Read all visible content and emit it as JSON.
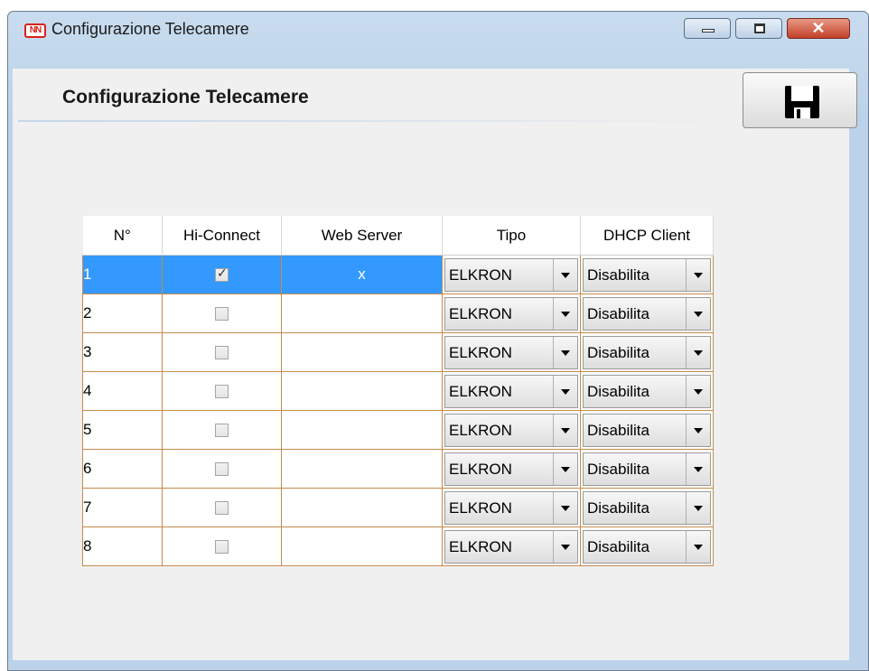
{
  "window": {
    "title": "Configurazione Telecamere",
    "icon": "app-logo-icon",
    "icon_text": "NN",
    "controls": [
      "minimize-icon",
      "maximize-icon",
      "close-icon"
    ]
  },
  "header": {
    "title": "Configurazione Telecamere",
    "save_icon": "floppy-disk-icon"
  },
  "table": {
    "columns": [
      "N°",
      "Hi-Connect",
      "Web Server",
      "Tipo",
      "DHCP Client"
    ],
    "rows": [
      {
        "n": "1",
        "hi_connect": true,
        "web_server": "x",
        "tipo": "ELKRON",
        "dhcp": "Disabilita",
        "selected": true
      },
      {
        "n": "2",
        "hi_connect": false,
        "web_server": "",
        "tipo": "ELKRON",
        "dhcp": "Disabilita",
        "selected": false
      },
      {
        "n": "3",
        "hi_connect": false,
        "web_server": "",
        "tipo": "ELKRON",
        "dhcp": "Disabilita",
        "selected": false
      },
      {
        "n": "4",
        "hi_connect": false,
        "web_server": "",
        "tipo": "ELKRON",
        "dhcp": "Disabilita",
        "selected": false
      },
      {
        "n": "5",
        "hi_connect": false,
        "web_server": "",
        "tipo": "ELKRON",
        "dhcp": "Disabilita",
        "selected": false
      },
      {
        "n": "6",
        "hi_connect": false,
        "web_server": "",
        "tipo": "ELKRON",
        "dhcp": "Disabilita",
        "selected": false
      },
      {
        "n": "7",
        "hi_connect": false,
        "web_server": "",
        "tipo": "ELKRON",
        "dhcp": "Disabilita",
        "selected": false
      },
      {
        "n": "8",
        "hi_connect": false,
        "web_server": "",
        "tipo": "ELKRON",
        "dhcp": "Disabilita",
        "selected": false
      }
    ]
  },
  "colors": {
    "selection": "#3399ff",
    "grid_border": "#c58a4c",
    "title_gradient": "#bcd2ea",
    "close_button": "#c2402a"
  }
}
